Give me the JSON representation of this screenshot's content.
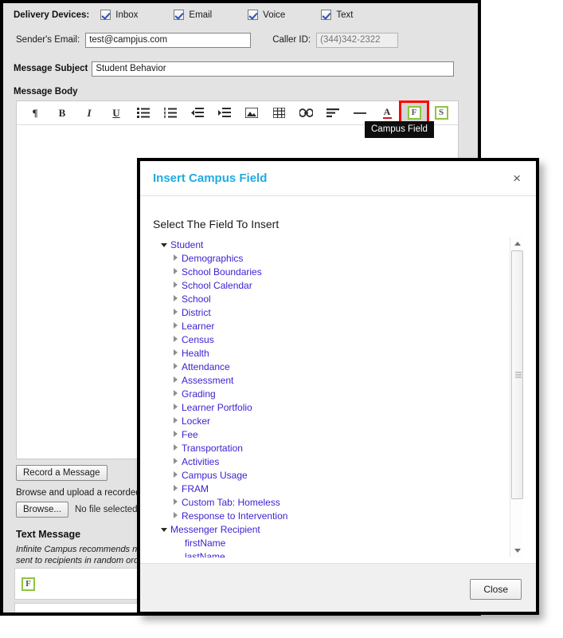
{
  "form": {
    "delivery_label": "Delivery Devices:",
    "devices": [
      {
        "label": "Inbox",
        "checked": true
      },
      {
        "label": "Email",
        "checked": true
      },
      {
        "label": "Voice",
        "checked": true
      },
      {
        "label": "Text",
        "checked": true
      }
    ],
    "sender_label": "Sender's Email:",
    "sender_value": "test@campjus.com",
    "caller_label": "Caller ID:",
    "caller_placeholder": "(344)342-2322",
    "subject_label": "Message Subject",
    "subject_value": "Student Behavior",
    "body_label": "Message Body",
    "record_button": "Record a Message",
    "browse_text": "Browse and upload a recorded",
    "browse_button": "Browse...",
    "no_file_text": "No file selected.",
    "text_message_label": "Text Message",
    "text_message_note_line1": "Infinite Campus recommends n",
    "text_message_note_line2": "sent to recipients in random ord"
  },
  "toolbar": {
    "tooltip": "Campus Field",
    "buttons": [
      {
        "name": "paragraph-icon",
        "glyph": "¶",
        "kind": "text"
      },
      {
        "name": "bold-icon",
        "glyph": "B",
        "kind": "bold"
      },
      {
        "name": "italic-icon",
        "glyph": "I",
        "kind": "italic"
      },
      {
        "name": "underline-icon",
        "glyph": "U",
        "kind": "underline"
      },
      {
        "name": "bullet-list-icon",
        "glyph": "",
        "kind": "ul"
      },
      {
        "name": "numbered-list-icon",
        "glyph": "",
        "kind": "ol"
      },
      {
        "name": "outdent-icon",
        "glyph": "",
        "kind": "outdent"
      },
      {
        "name": "indent-icon",
        "glyph": "",
        "kind": "indent"
      },
      {
        "name": "image-icon",
        "glyph": "",
        "kind": "image"
      },
      {
        "name": "table-icon",
        "glyph": "",
        "kind": "table"
      },
      {
        "name": "link-icon",
        "glyph": "",
        "kind": "link"
      },
      {
        "name": "align-icon",
        "glyph": "",
        "kind": "align"
      },
      {
        "name": "horizontal-rule-icon",
        "glyph": "",
        "kind": "hr"
      },
      {
        "name": "text-color-icon",
        "glyph": "A",
        "kind": "textcolor"
      },
      {
        "name": "campus-field-icon",
        "glyph": "F",
        "kind": "boxed"
      },
      {
        "name": "campus-symbol-icon",
        "glyph": "S",
        "kind": "boxed"
      }
    ],
    "accent_highlight": "#ff0000",
    "boxed_border": "#8cc63f"
  },
  "sms_field_glyph": "F",
  "dialog": {
    "title": "Insert Campus Field",
    "close_icon": "×",
    "prompt": "Select The Field To Insert",
    "close_button": "Close",
    "title_color": "#23aae1",
    "tree": [
      {
        "label": "Student",
        "level": 0,
        "state": "expanded"
      },
      {
        "label": "Demographics",
        "level": 1,
        "state": "collapsed"
      },
      {
        "label": "School Boundaries",
        "level": 1,
        "state": "collapsed"
      },
      {
        "label": "School Calendar",
        "level": 1,
        "state": "collapsed"
      },
      {
        "label": "School",
        "level": 1,
        "state": "collapsed"
      },
      {
        "label": "District",
        "level": 1,
        "state": "collapsed"
      },
      {
        "label": "Learner",
        "level": 1,
        "state": "collapsed"
      },
      {
        "label": "Census",
        "level": 1,
        "state": "collapsed"
      },
      {
        "label": "Health",
        "level": 1,
        "state": "collapsed"
      },
      {
        "label": "Attendance",
        "level": 1,
        "state": "collapsed"
      },
      {
        "label": "Assessment",
        "level": 1,
        "state": "collapsed"
      },
      {
        "label": "Grading",
        "level": 1,
        "state": "collapsed"
      },
      {
        "label": "Learner Portfolio",
        "level": 1,
        "state": "collapsed"
      },
      {
        "label": "Locker",
        "level": 1,
        "state": "collapsed"
      },
      {
        "label": "Fee",
        "level": 1,
        "state": "collapsed"
      },
      {
        "label": "Transportation",
        "level": 1,
        "state": "collapsed"
      },
      {
        "label": "Activities",
        "level": 1,
        "state": "collapsed"
      },
      {
        "label": "Campus Usage",
        "level": 1,
        "state": "collapsed"
      },
      {
        "label": "FRAM",
        "level": 1,
        "state": "collapsed"
      },
      {
        "label": "Custom Tab: Homeless",
        "level": 1,
        "state": "collapsed"
      },
      {
        "label": "Response to Intervention",
        "level": 1,
        "state": "collapsed"
      },
      {
        "label": "Messenger Recipient",
        "level": 0,
        "state": "expanded"
      },
      {
        "label": "firstName",
        "level": 2,
        "state": "leaf"
      },
      {
        "label": "lastName",
        "level": 2,
        "state": "leaf"
      }
    ]
  }
}
